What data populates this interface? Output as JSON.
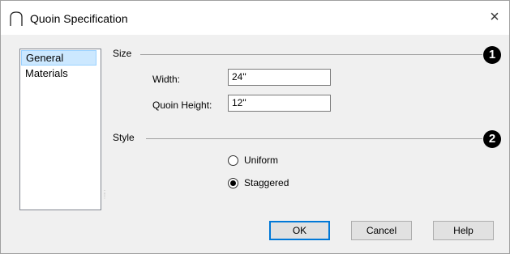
{
  "window": {
    "title": "Quoin Specification",
    "close_label": "×",
    "app_icon": "arch-icon"
  },
  "sidebar": {
    "items": [
      {
        "label": "General",
        "selected": true
      },
      {
        "label": "Materials",
        "selected": false
      }
    ]
  },
  "size_section": {
    "label": "Size",
    "badge": "1",
    "width_label": "Width:",
    "width_value": "24\"",
    "height_label": "Quoin Height:",
    "height_value": "12\""
  },
  "style_section": {
    "label": "Style",
    "badge": "2",
    "options": [
      {
        "label": "Uniform",
        "checked": false
      },
      {
        "label": "Staggered",
        "checked": true
      }
    ]
  },
  "buttons": {
    "ok": "OK",
    "cancel": "Cancel",
    "help": "Help"
  },
  "colors": {
    "selection_bg": "#cce8ff",
    "default_button_border": "#0078d7"
  }
}
